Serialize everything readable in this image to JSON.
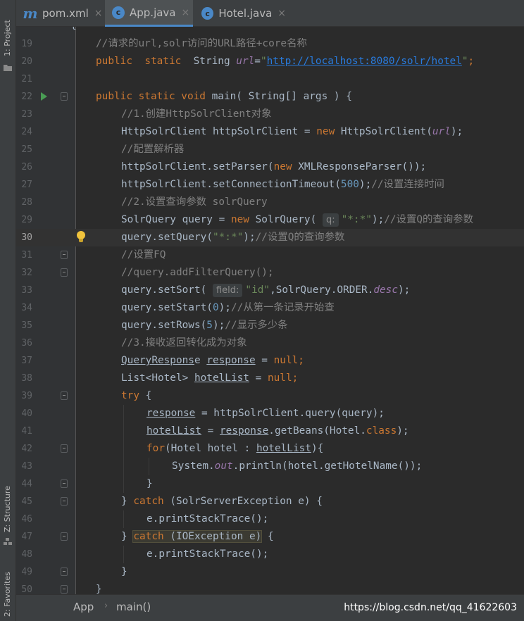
{
  "sidebar": {
    "project_label": "1: Project",
    "structure_label": "Z: Structure",
    "favorites_label": "2: Favorites"
  },
  "tabs": [
    {
      "label": "pom.xml",
      "icon": "maven-m-icon",
      "active": false
    },
    {
      "label": "App.java",
      "icon": "java-class-icon",
      "active": true
    },
    {
      "label": "Hotel.java",
      "icon": "java-class-icon",
      "active": false
    }
  ],
  "tab_close_glyph": "×",
  "code": {
    "first_line_fragment": "{",
    "lines": [
      {
        "n": "19",
        "text": "//请求的url,solr访问的URL路径+core名称"
      },
      {
        "n": "20",
        "text": "public static String url=\"http://localhost:8080/solr/hotel\";"
      },
      {
        "n": "21",
        "text": ""
      },
      {
        "n": "22",
        "text": "public static void main( String[] args ) {"
      },
      {
        "n": "23",
        "text": "//1.创建HttpSolrClient对象"
      },
      {
        "n": "24",
        "text": "HttpSolrClient httpSolrClient = new HttpSolrClient(url);"
      },
      {
        "n": "25",
        "text": "//配置解析器"
      },
      {
        "n": "26",
        "text": "httpSolrClient.setParser(new XMLResponseParser());"
      },
      {
        "n": "27",
        "text": "httpSolrClient.setConnectionTimeout(500);//设置连接时间"
      },
      {
        "n": "28",
        "text": "//2.设置查询参数 solrQuery"
      },
      {
        "n": "29",
        "text": "SolrQuery query = new SolrQuery( q: \"*:*\");//设置Q的查询参数"
      },
      {
        "n": "30",
        "text": "query.setQuery(\"*:*\");//设置Q的查询参数"
      },
      {
        "n": "31",
        "text": "//设置FQ"
      },
      {
        "n": "32",
        "text": "//query.addFilterQuery();"
      },
      {
        "n": "33",
        "text": "query.setSort( field: \"id\",SolrQuery.ORDER.desc);"
      },
      {
        "n": "34",
        "text": "query.setStart(0);//从第一条记录开始查"
      },
      {
        "n": "35",
        "text": "query.setRows(5);//显示多少条"
      },
      {
        "n": "36",
        "text": "//3.接收返回转化成为对象"
      },
      {
        "n": "37",
        "text": "QueryResponse response = null;"
      },
      {
        "n": "38",
        "text": "List<Hotel> hotelList = null;"
      },
      {
        "n": "39",
        "text": "try {"
      },
      {
        "n": "40",
        "text": "response = httpSolrClient.query(query);"
      },
      {
        "n": "41",
        "text": "hotelList = response.getBeans(Hotel.class);"
      },
      {
        "n": "42",
        "text": "for(Hotel hotel : hotelList){"
      },
      {
        "n": "43",
        "text": "System.out.println(hotel.getHotelName());"
      },
      {
        "n": "44",
        "text": "}"
      },
      {
        "n": "45",
        "text": "} catch (SolrServerException e) {"
      },
      {
        "n": "46",
        "text": "e.printStackTrace();"
      },
      {
        "n": "47",
        "text": "} catch (IOException e) {"
      },
      {
        "n": "48",
        "text": "e.printStackTrace();"
      },
      {
        "n": "49",
        "text": "}"
      },
      {
        "n": "50",
        "text": "}"
      }
    ]
  },
  "tokens": {
    "l19": "//请求的url,solr访问的URL路径+core名称",
    "l20_kw1": "public",
    "l20_kw2": "static",
    "l20_type": "String",
    "l20_var": "url",
    "l20_eq": "=",
    "l20_str_q1": "\"",
    "l20_url": "http://localhost:8080/solr/hotel",
    "l20_str_q2": "\"",
    "l20_semi": ";",
    "l22_kw": "public static void",
    "l22_rest": " main( String[] args ) {",
    "l23": "//1.创建HttpSolrClient对象",
    "l24_a": "HttpSolrClient httpSolrClient = ",
    "l24_kw": "new",
    "l24_b": " HttpSolrClient(",
    "l24_fld": "url",
    "l24_c": ");",
    "l25": "//配置解析器",
    "l26_a": "httpSolrClient.setParser(",
    "l26_kw": "new",
    "l26_b": " XMLResponseParser());",
    "l27_a": "httpSolrClient.setConnectionTimeout(",
    "l27_num": "500",
    "l27_b": ");",
    "l27_cm": "//设置连接时间",
    "l28": "//2.设置查询参数 solrQuery",
    "l29_a": "SolrQuery query = ",
    "l29_kw": "new",
    "l29_b": " SolrQuery(",
    "l29_hint": "q:",
    "l29_str": "\"*:*\"",
    "l29_c": ");",
    "l29_cm": "//设置Q的查询参数",
    "l30_a": "query.setQuery(",
    "l30_str": "\"*:*\"",
    "l30_b": ");",
    "l30_cm": "//设置Q的查询参数",
    "l31": "//设置FQ",
    "l32": "//query.addFilterQuery();",
    "l33_a": "query.setSort(",
    "l33_hint": "field:",
    "l33_str": "\"id\"",
    "l33_b": ",SolrQuery.ORDER.",
    "l33_fld": "desc",
    "l33_c": ");",
    "l34_a": "query.setStart(",
    "l34_num": "0",
    "l34_b": ");",
    "l34_cm": "//从第一条记录开始查",
    "l35_a": "query.setRows(",
    "l35_num": "5",
    "l35_b": ");",
    "l35_cm": "//显示多少条",
    "l36": "//3.接收返回转化成为对象",
    "l37_type": "QueryRespons",
    "l37_e": "e",
    "l37_var": "response",
    "l37_eq": " = ",
    "l37_kw": "null",
    "l37_semi": ";",
    "l38_a": "List<Hotel> ",
    "l38_var": "hotelList",
    "l38_eq": " = ",
    "l38_kw": "null",
    "l38_semi": ";",
    "l39_kw": "try",
    "l39_b": " {",
    "l40_var": "response",
    "l40_b": " = httpSolrClient.query(query);",
    "l41_var": "hotelList",
    "l41_b": " = ",
    "l41_var2": "response",
    "l41_c": ".getBeans(Hotel.",
    "l41_kw": "class",
    "l41_d": ");",
    "l42_kw": "for",
    "l42_b": "(Hotel hotel : ",
    "l42_var": "hotelList",
    "l42_c": "){",
    "l43_a": "System.",
    "l43_fld": "out",
    "l43_b": ".println(hotel.getHotelName());",
    "l44": "}",
    "l45_a": "} ",
    "l45_kw": "catch",
    "l45_b": " (SolrServerException e) {",
    "l46": "e.printStackTrace();",
    "l47_a": "} ",
    "l47_kw": "catch",
    "l47_b": " (IOException e)",
    "l47_c": " {",
    "l48": "e.printStackTrace();",
    "l49": "}",
    "l50": "}"
  },
  "breadcrumb": {
    "class": "App",
    "separator": "›",
    "method": "main()"
  },
  "watermark": "https://blog.csdn.net/qq_41622603",
  "colors": {
    "background": "#2b2b2b",
    "keyword": "#cc7832",
    "comment": "#808080",
    "string": "#6a8759",
    "number": "#6897bb",
    "field": "#9876aa",
    "link": "#287bde",
    "accent": "#4a88c7"
  }
}
